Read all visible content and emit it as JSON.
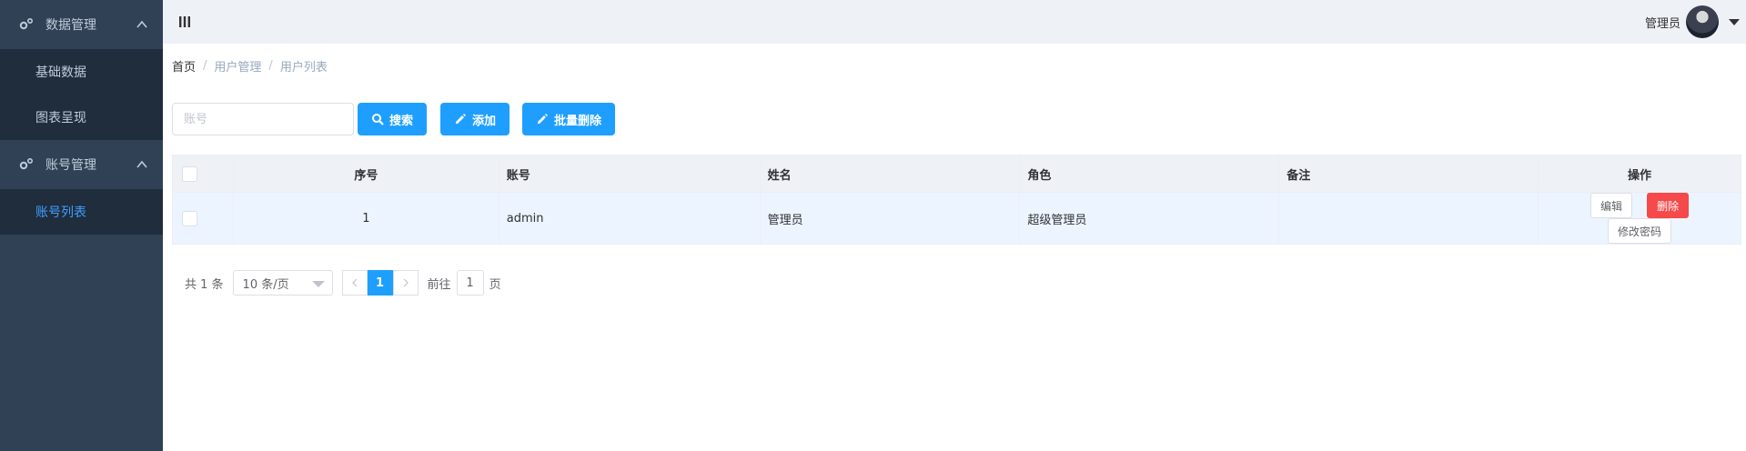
{
  "sidebar": {
    "groups": [
      {
        "title": "数据管理",
        "items": [
          {
            "label": "基础数据"
          },
          {
            "label": "图表呈现"
          }
        ]
      },
      {
        "title": "账号管理",
        "items": [
          {
            "label": "账号列表"
          }
        ]
      }
    ]
  },
  "navbar": {
    "user_name": "管理员"
  },
  "breadcrumb": {
    "home": "首页",
    "level1": "用户管理",
    "level2": "用户列表"
  },
  "toolbar": {
    "search_placeholder": "账号",
    "search_label": "搜索",
    "add_label": "添加",
    "batch_delete_label": "批量删除"
  },
  "table": {
    "headers": {
      "index": "序号",
      "account": "账号",
      "name": "姓名",
      "role": "角色",
      "remark": "备注",
      "actions": "操作"
    },
    "rows": [
      {
        "index": "1",
        "account": "admin",
        "name": "管理员",
        "role": "超级管理员",
        "remark": ""
      }
    ],
    "actions": {
      "edit": "编辑",
      "delete": "删除",
      "change_password": "修改密码"
    }
  },
  "pagination": {
    "total_text": "共 1 条",
    "page_size": "10 条/页",
    "current_page": "1",
    "goto_label": "前往",
    "goto_value": "1",
    "page_unit": "页"
  },
  "colors": {
    "sidebar_bg": "#304156",
    "submenu_bg": "#1f2d3d",
    "primary": "#1e9fff",
    "danger": "#f5494a",
    "active_menu": "#409eff"
  }
}
